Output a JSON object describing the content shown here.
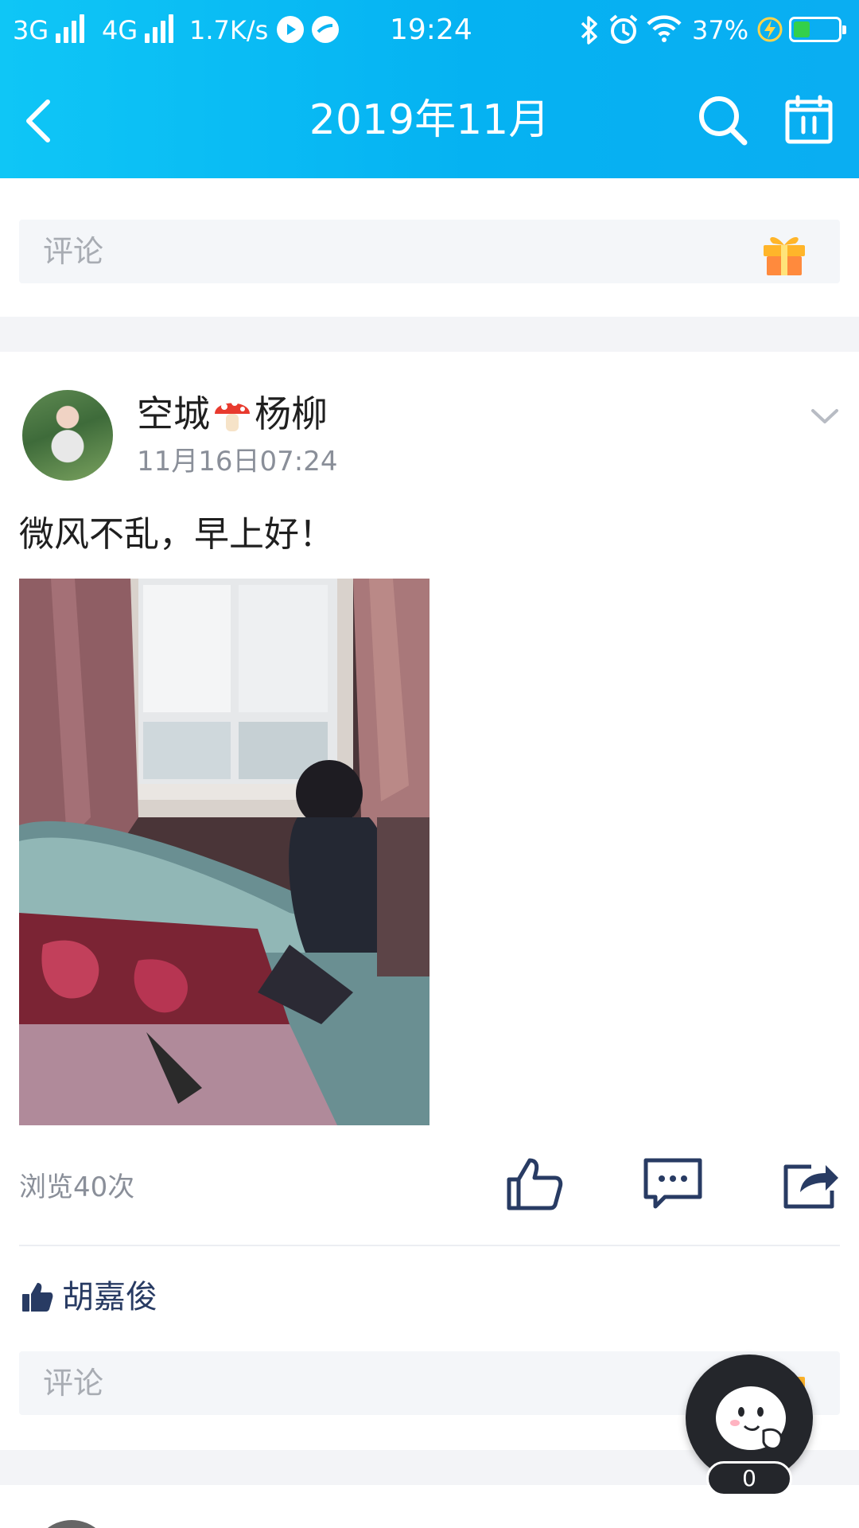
{
  "status_bar": {
    "net1": "3G",
    "net2": "4G",
    "speed": "1.7K/s",
    "time": "19:24",
    "battery_percent": "37%",
    "battery_level": 0.37,
    "icons": [
      "play-circle-icon",
      "browser-icon",
      "bluetooth-icon",
      "alarm-icon",
      "wifi-icon",
      "charging-icon",
      "battery-icon"
    ]
  },
  "nav": {
    "title": "2019年11月",
    "icons": [
      "back-chevron-icon",
      "search-icon",
      "calendar-icon"
    ]
  },
  "prev_post": {
    "comment_placeholder": "评论"
  },
  "post": {
    "author": {
      "name_part1": "空城",
      "name_part2": "杨柳",
      "name_emoji": "mushroom-icon"
    },
    "timestamp": "11月16日07:24",
    "text": "微风不乱，早上好！",
    "view_count": "浏览40次",
    "actions": [
      "thumbs-up-icon",
      "comment-icon",
      "share-icon"
    ],
    "likes": {
      "names": "胡嘉俊"
    },
    "comment_placeholder": "评论"
  },
  "floating": {
    "count": "0"
  },
  "colors": {
    "header_gradient_start": "#0fc6f6",
    "header_gradient_end": "#0aaef2",
    "like_blue": "#283b63",
    "placeholder_gray": "#a8acb3",
    "comment_bg": "#f4f6f9"
  }
}
